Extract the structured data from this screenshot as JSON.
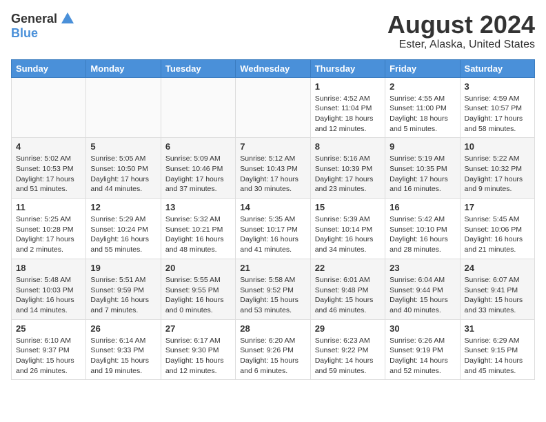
{
  "header": {
    "logo_general": "General",
    "logo_blue": "Blue",
    "title": "August 2024",
    "subtitle": "Ester, Alaska, United States"
  },
  "days_of_week": [
    "Sunday",
    "Monday",
    "Tuesday",
    "Wednesday",
    "Thursday",
    "Friday",
    "Saturday"
  ],
  "weeks": [
    {
      "days": [
        {
          "num": "",
          "info": "",
          "empty": true
        },
        {
          "num": "",
          "info": "",
          "empty": true
        },
        {
          "num": "",
          "info": "",
          "empty": true
        },
        {
          "num": "",
          "info": "",
          "empty": true
        },
        {
          "num": "1",
          "info": "Sunrise: 4:52 AM\nSunset: 11:04 PM\nDaylight: 18 hours\nand 12 minutes.",
          "empty": false
        },
        {
          "num": "2",
          "info": "Sunrise: 4:55 AM\nSunset: 11:00 PM\nDaylight: 18 hours\nand 5 minutes.",
          "empty": false
        },
        {
          "num": "3",
          "info": "Sunrise: 4:59 AM\nSunset: 10:57 PM\nDaylight: 17 hours\nand 58 minutes.",
          "empty": false
        }
      ]
    },
    {
      "days": [
        {
          "num": "4",
          "info": "Sunrise: 5:02 AM\nSunset: 10:53 PM\nDaylight: 17 hours\nand 51 minutes.",
          "empty": false
        },
        {
          "num": "5",
          "info": "Sunrise: 5:05 AM\nSunset: 10:50 PM\nDaylight: 17 hours\nand 44 minutes.",
          "empty": false
        },
        {
          "num": "6",
          "info": "Sunrise: 5:09 AM\nSunset: 10:46 PM\nDaylight: 17 hours\nand 37 minutes.",
          "empty": false
        },
        {
          "num": "7",
          "info": "Sunrise: 5:12 AM\nSunset: 10:43 PM\nDaylight: 17 hours\nand 30 minutes.",
          "empty": false
        },
        {
          "num": "8",
          "info": "Sunrise: 5:16 AM\nSunset: 10:39 PM\nDaylight: 17 hours\nand 23 minutes.",
          "empty": false
        },
        {
          "num": "9",
          "info": "Sunrise: 5:19 AM\nSunset: 10:35 PM\nDaylight: 17 hours\nand 16 minutes.",
          "empty": false
        },
        {
          "num": "10",
          "info": "Sunrise: 5:22 AM\nSunset: 10:32 PM\nDaylight: 17 hours\nand 9 minutes.",
          "empty": false
        }
      ]
    },
    {
      "days": [
        {
          "num": "11",
          "info": "Sunrise: 5:25 AM\nSunset: 10:28 PM\nDaylight: 17 hours\nand 2 minutes.",
          "empty": false
        },
        {
          "num": "12",
          "info": "Sunrise: 5:29 AM\nSunset: 10:24 PM\nDaylight: 16 hours\nand 55 minutes.",
          "empty": false
        },
        {
          "num": "13",
          "info": "Sunrise: 5:32 AM\nSunset: 10:21 PM\nDaylight: 16 hours\nand 48 minutes.",
          "empty": false
        },
        {
          "num": "14",
          "info": "Sunrise: 5:35 AM\nSunset: 10:17 PM\nDaylight: 16 hours\nand 41 minutes.",
          "empty": false
        },
        {
          "num": "15",
          "info": "Sunrise: 5:39 AM\nSunset: 10:14 PM\nDaylight: 16 hours\nand 34 minutes.",
          "empty": false
        },
        {
          "num": "16",
          "info": "Sunrise: 5:42 AM\nSunset: 10:10 PM\nDaylight: 16 hours\nand 28 minutes.",
          "empty": false
        },
        {
          "num": "17",
          "info": "Sunrise: 5:45 AM\nSunset: 10:06 PM\nDaylight: 16 hours\nand 21 minutes.",
          "empty": false
        }
      ]
    },
    {
      "days": [
        {
          "num": "18",
          "info": "Sunrise: 5:48 AM\nSunset: 10:03 PM\nDaylight: 16 hours\nand 14 minutes.",
          "empty": false
        },
        {
          "num": "19",
          "info": "Sunrise: 5:51 AM\nSunset: 9:59 PM\nDaylight: 16 hours\nand 7 minutes.",
          "empty": false
        },
        {
          "num": "20",
          "info": "Sunrise: 5:55 AM\nSunset: 9:55 PM\nDaylight: 16 hours\nand 0 minutes.",
          "empty": false
        },
        {
          "num": "21",
          "info": "Sunrise: 5:58 AM\nSunset: 9:52 PM\nDaylight: 15 hours\nand 53 minutes.",
          "empty": false
        },
        {
          "num": "22",
          "info": "Sunrise: 6:01 AM\nSunset: 9:48 PM\nDaylight: 15 hours\nand 46 minutes.",
          "empty": false
        },
        {
          "num": "23",
          "info": "Sunrise: 6:04 AM\nSunset: 9:44 PM\nDaylight: 15 hours\nand 40 minutes.",
          "empty": false
        },
        {
          "num": "24",
          "info": "Sunrise: 6:07 AM\nSunset: 9:41 PM\nDaylight: 15 hours\nand 33 minutes.",
          "empty": false
        }
      ]
    },
    {
      "days": [
        {
          "num": "25",
          "info": "Sunrise: 6:10 AM\nSunset: 9:37 PM\nDaylight: 15 hours\nand 26 minutes.",
          "empty": false
        },
        {
          "num": "26",
          "info": "Sunrise: 6:14 AM\nSunset: 9:33 PM\nDaylight: 15 hours\nand 19 minutes.",
          "empty": false
        },
        {
          "num": "27",
          "info": "Sunrise: 6:17 AM\nSunset: 9:30 PM\nDaylight: 15 hours\nand 12 minutes.",
          "empty": false
        },
        {
          "num": "28",
          "info": "Sunrise: 6:20 AM\nSunset: 9:26 PM\nDaylight: 15 hours\nand 6 minutes.",
          "empty": false
        },
        {
          "num": "29",
          "info": "Sunrise: 6:23 AM\nSunset: 9:22 PM\nDaylight: 14 hours\nand 59 minutes.",
          "empty": false
        },
        {
          "num": "30",
          "info": "Sunrise: 6:26 AM\nSunset: 9:19 PM\nDaylight: 14 hours\nand 52 minutes.",
          "empty": false
        },
        {
          "num": "31",
          "info": "Sunrise: 6:29 AM\nSunset: 9:15 PM\nDaylight: 14 hours\nand 45 minutes.",
          "empty": false
        }
      ]
    }
  ]
}
